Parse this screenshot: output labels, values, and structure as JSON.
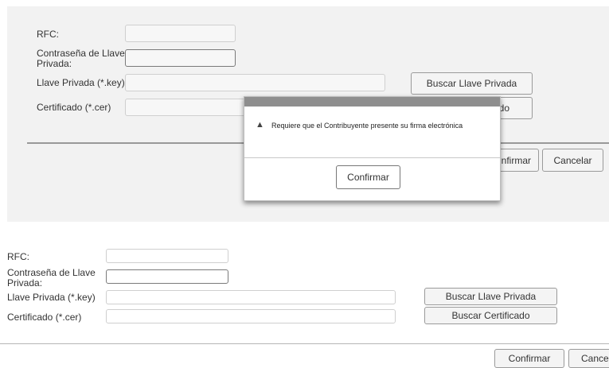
{
  "top_form": {
    "rfc_label": "RFC:",
    "password_label": "Contraseña de Llave Privada:",
    "key_label": "Llave Privada (*.key)",
    "cert_label": "Certificado (*.cer)",
    "search_key_button": "Buscar Llave Privada",
    "search_cert_button_visible": "do",
    "confirm_button_visible": "nfirmar",
    "cancel_button": "Cancelar"
  },
  "modal": {
    "icon": "warning-icon",
    "message": "Requiere que el Contribuyente presente su firma electrónica",
    "confirm_button": "Confirmar"
  },
  "bottom_form": {
    "rfc_label": "RFC:",
    "password_label": "Contraseña de Llave Privada:",
    "key_label": "Llave Privada (*.key)",
    "cert_label": "Certificado (*.cer)",
    "search_key_button": "Buscar Llave Privada",
    "search_cert_button": "Buscar Certificado",
    "confirm_button": "Confirmar",
    "cancel_button_visible": "Cance"
  }
}
